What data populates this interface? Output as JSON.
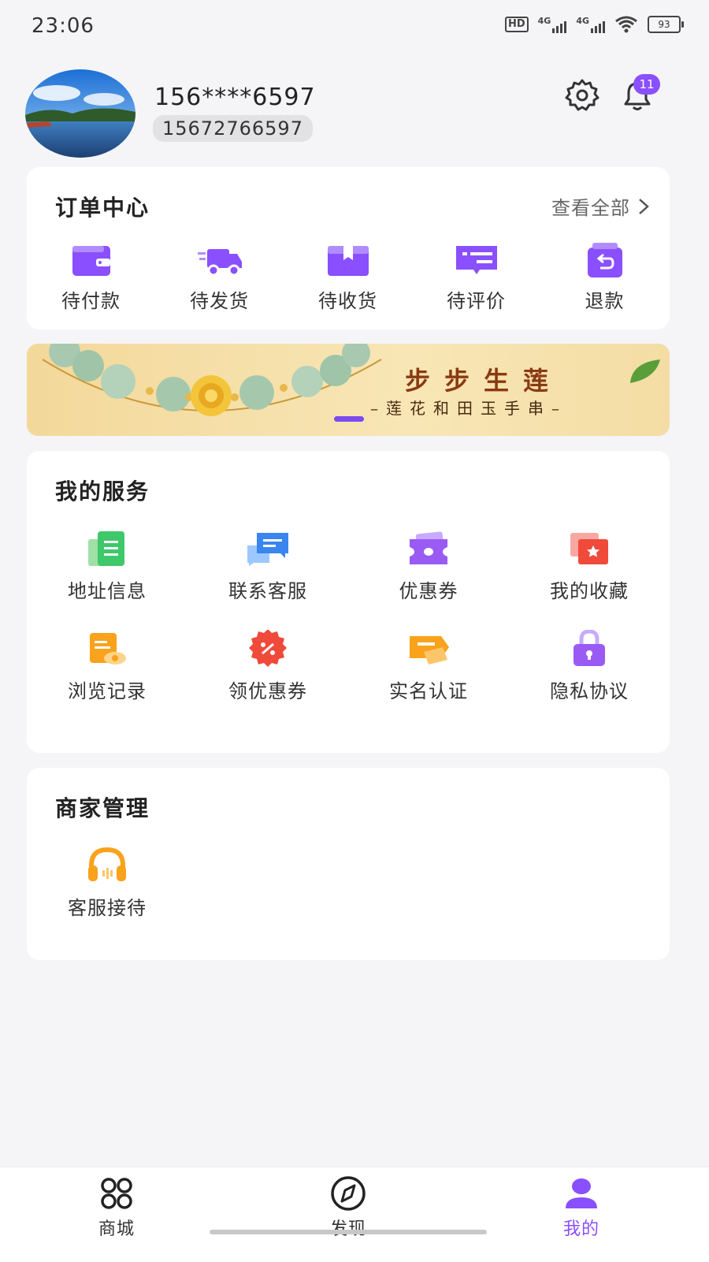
{
  "status_bar": {
    "time": "23:06",
    "hd": "HD",
    "net1": "4G",
    "net2": "4G",
    "battery": "93"
  },
  "profile": {
    "masked_phone": "156****6597",
    "phone": "15672766597",
    "notification_count": "11"
  },
  "orders": {
    "title": "订单中心",
    "view_all": "查看全部",
    "items": [
      {
        "label": "待付款",
        "icon": "wallet-icon"
      },
      {
        "label": "待发货",
        "icon": "truck-icon"
      },
      {
        "label": "待收货",
        "icon": "package-icon"
      },
      {
        "label": "待评价",
        "icon": "review-icon"
      },
      {
        "label": "退款",
        "icon": "refund-icon"
      }
    ]
  },
  "banner": {
    "title": "步步生莲",
    "subtitle": "–莲花和田玉手串–"
  },
  "services": {
    "title": "我的服务",
    "items": [
      {
        "label": "地址信息",
        "icon": "address-icon"
      },
      {
        "label": "联系客服",
        "icon": "chat-icon"
      },
      {
        "label": "优惠券",
        "icon": "ticket-icon"
      },
      {
        "label": "我的收藏",
        "icon": "favorites-icon"
      },
      {
        "label": "浏览记录",
        "icon": "history-icon"
      },
      {
        "label": "领优惠券",
        "icon": "discount-icon"
      },
      {
        "label": "实名认证",
        "icon": "verify-icon"
      },
      {
        "label": "隐私协议",
        "icon": "lock-icon"
      }
    ]
  },
  "merchant": {
    "title": "商家管理",
    "items": [
      {
        "label": "客服接待",
        "icon": "headset-icon"
      }
    ]
  },
  "tabbar": {
    "items": [
      {
        "label": "商城"
      },
      {
        "label": "发现"
      },
      {
        "label": "我的"
      }
    ],
    "active_color": "#8a4fff"
  },
  "colors": {
    "accent": "#8a4fff",
    "background": "#f5f5f7"
  }
}
